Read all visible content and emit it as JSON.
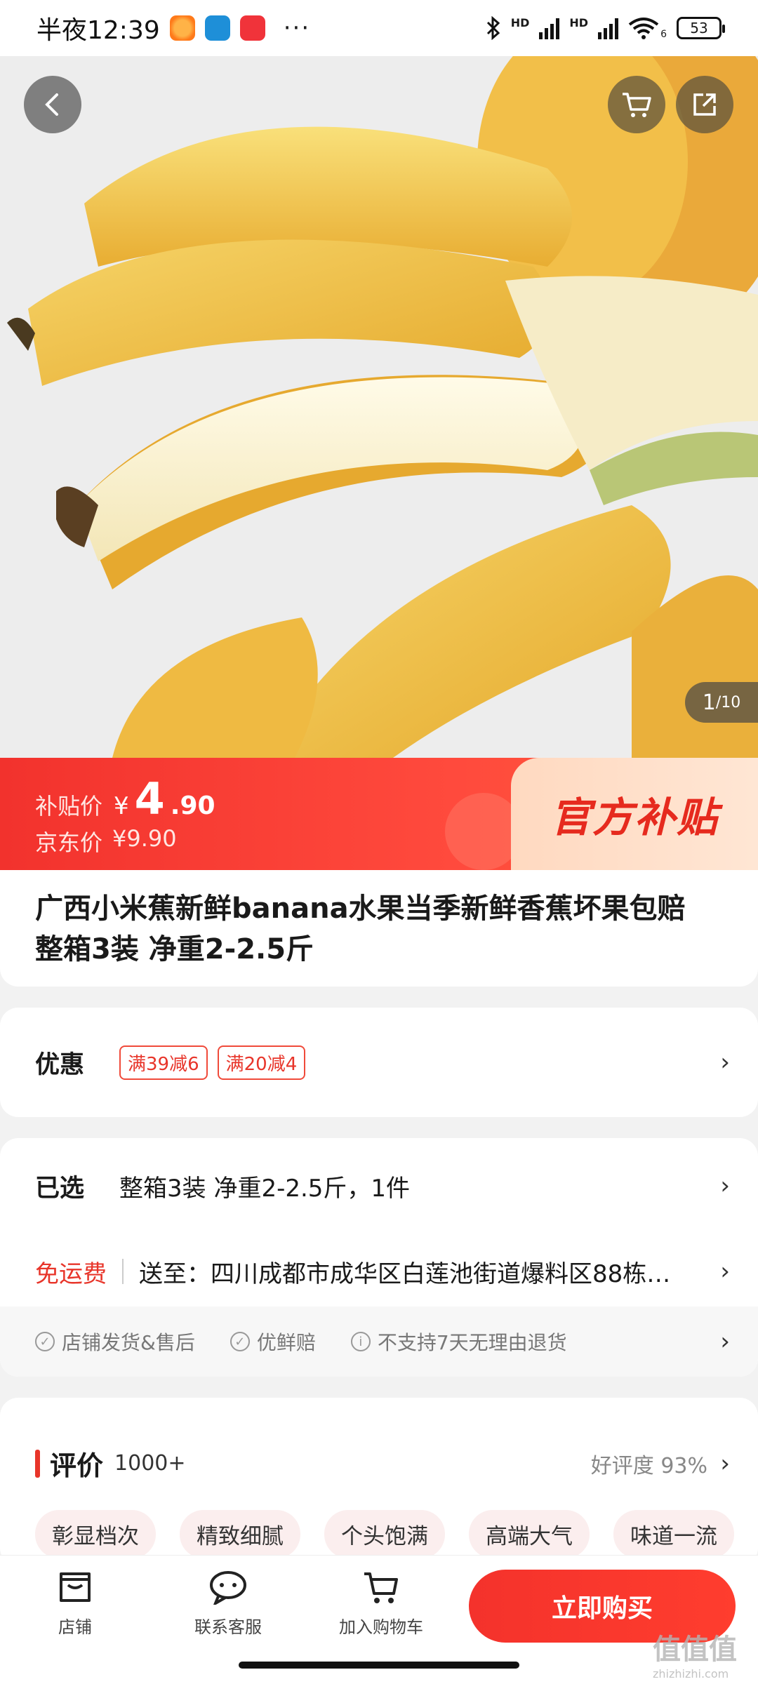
{
  "status_bar": {
    "time": "半夜12:39",
    "dots": "···",
    "hd1": "HD",
    "hd2": "HD",
    "wifi_sub": "6",
    "battery": "53"
  },
  "hero": {
    "page_current": "1",
    "page_total": "/10"
  },
  "price": {
    "subsidy_label": "补贴价",
    "currency": "¥",
    "subsidy_int": "4",
    "subsidy_dec": ".90",
    "jd_label": "京东价",
    "jd_price": "¥9.90",
    "badge": "官方补贴"
  },
  "product": {
    "title": "广西小米蕉新鲜banana水果当季新鲜香蕉坏果包赔 整箱3装 净重2-2.5斤"
  },
  "promo": {
    "label": "优惠",
    "coupons": [
      "满39减6",
      "满20减4"
    ]
  },
  "selection": {
    "label": "已选",
    "value": "整箱3装 净重2-2.5斤，1件"
  },
  "shipping": {
    "label": "免运费",
    "address": "送至：四川成都市成华区白莲池街道爆料区88栋…"
  },
  "services": [
    "店铺发货&售后",
    "优鲜赔",
    "不支持7天无理由退货"
  ],
  "reviews": {
    "title": "评价",
    "count": "1000+",
    "rate": "好评度 93%",
    "tags": [
      "彰显档次",
      "精致细腻",
      "个头饱满",
      "高端大气",
      "味道一流"
    ]
  },
  "bottom_bar": {
    "store": "店铺",
    "service": "联系客服",
    "add_cart": "加入购物车",
    "buy": "立即购买"
  },
  "watermark": {
    "main": "值值值",
    "sub": "zhizhizhi.com"
  },
  "colors": {
    "accent": "#f2322d",
    "banana": "#f2c24a"
  }
}
